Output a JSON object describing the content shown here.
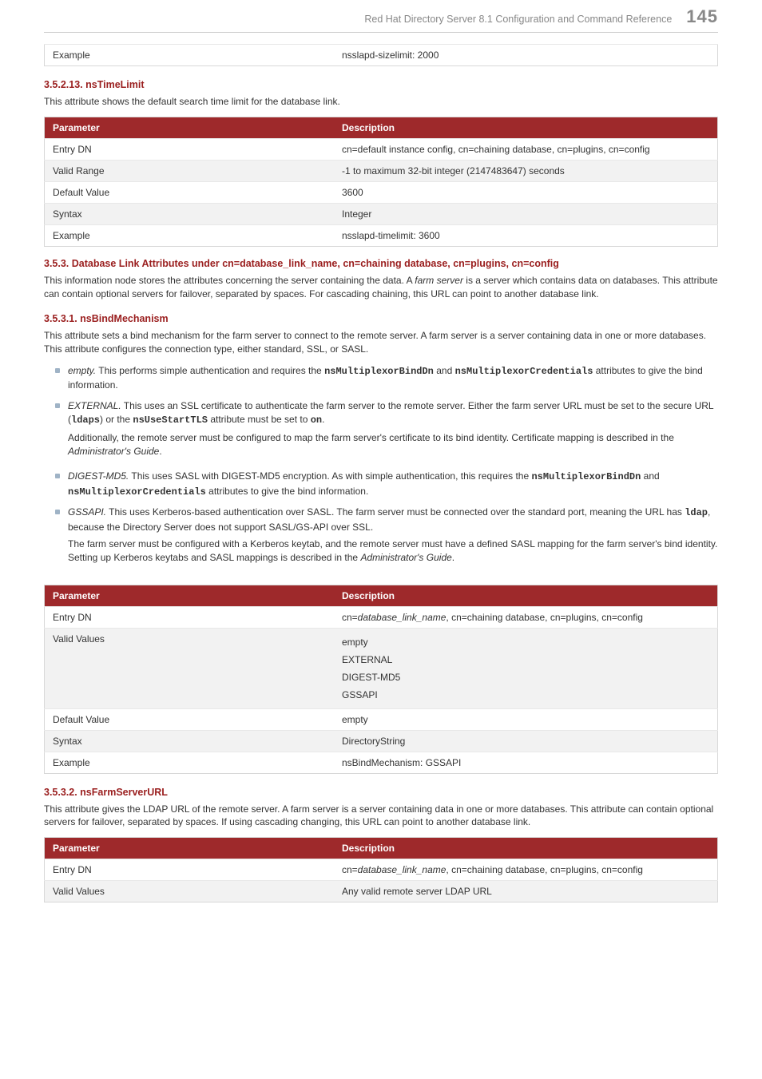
{
  "header": {
    "doc_title": "Red Hat Directory Server 8.1 Configuration and Command Reference",
    "page_number": "145"
  },
  "table_prev": {
    "r0c0": "Example",
    "r0c1": "nsslapd-sizelimit: 2000"
  },
  "sec_35213": {
    "heading": "3.5.2.13. nsTimeLimit",
    "intro": "This attribute shows the default search time limit for the database link.",
    "table": {
      "h0": "Parameter",
      "h1": "Description",
      "rows": [
        {
          "c0": "Entry DN",
          "c1": "cn=default instance config, cn=chaining database, cn=plugins, cn=config"
        },
        {
          "c0": "Valid Range",
          "c1": "-1 to maximum 32-bit integer (2147483647) seconds"
        },
        {
          "c0": "Default Value",
          "c1": "3600"
        },
        {
          "c0": "Syntax",
          "c1": "Integer"
        },
        {
          "c0": "Example",
          "c1": "nsslapd-timelimit: 3600"
        }
      ]
    }
  },
  "sec_353": {
    "heading": "3.5.3. Database Link Attributes under cn=database_link_name, cn=chaining database, cn=plugins, cn=config",
    "body_pre": "This information node stores the attributes concerning the server containing the data. A ",
    "body_italic": "farm server",
    "body_post": " is a server which contains data on databases. This attribute can contain optional servers for failover, separated by spaces. For cascading chaining, this URL can point to another database link."
  },
  "sec_3531": {
    "heading": "3.5.3.1. nsBindMechanism",
    "intro": "This attribute sets a bind mechanism for the farm server to connect to the remote server. A farm server is a server containing data in one or more databases. This attribute configures the connection type, either standard, SSL, or SASL.",
    "bullets": {
      "b1": {
        "name": "empty.",
        "t1": " This performs simple authentication and requires the ",
        "m1": "nsMultiplexorBindDn",
        "t2": " and ",
        "m2": "nsMultiplexorCredentials",
        "t3": " attributes to give the bind information."
      },
      "b2": {
        "name": "EXTERNAL.",
        "t1": " This uses an SSL certificate to authenticate the farm server to the remote server. Either the farm server URL must be set to the secure URL (",
        "m1": "ldaps",
        "t2": ") or the ",
        "m2": "nsUseStartTLS",
        "t3": " attribute must be set to ",
        "m3": "on",
        "t4": ".",
        "p2a": "Additionally, the remote server must be configured to map the farm server's certificate to its bind identity. Certificate mapping is described in the ",
        "p2i": "Administrator's Guide",
        "p2b": "."
      },
      "b3": {
        "name": "DIGEST-MD5.",
        "t1": " This uses SASL with DIGEST-MD5 encryption. As with simple authentication, this requires the ",
        "m1": "nsMultiplexorBindDn",
        "t2": " and ",
        "m2": "nsMultiplexorCredentials",
        "t3": " attributes to give the bind information."
      },
      "b4": {
        "name": "GSSAPI.",
        "t1": " This uses Kerberos-based authentication over SASL. The farm server must be connected over the standard port, meaning the URL has ",
        "m1": "ldap",
        "t2": ", because the Directory Server does not support SASL/GS-API over SSL.",
        "p2a": "The farm server must be configured with a Kerberos keytab, and the remote server must have a defined SASL mapping for the farm server's bind identity. Setting up Kerberos keytabs and SASL mappings is described in the ",
        "p2i": "Administrator's Guide",
        "p2b": "."
      }
    },
    "table": {
      "h0": "Parameter",
      "h1": "Description",
      "r0c0": "Entry DN",
      "r0c1a": "cn=",
      "r0c1i": "database_link_name",
      "r0c1b": ", cn=chaining database, cn=plugins, cn=config",
      "r1c0": "Valid Values",
      "r1v0": "empty",
      "r1v1": "EXTERNAL",
      "r1v2": "DIGEST-MD5",
      "r1v3": "GSSAPI",
      "r2c0": "Default Value",
      "r2c1": "empty",
      "r3c0": "Syntax",
      "r3c1": "DirectoryString",
      "r4c0": "Example",
      "r4c1": "nsBindMechanism: GSSAPI"
    }
  },
  "sec_3532": {
    "heading": "3.5.3.2. nsFarmServerURL",
    "intro": "This attribute gives the LDAP URL of the remote server. A farm server is a server containing data in one or more databases. This attribute can contain optional servers for failover, separated by spaces. If using cascading changing, this URL can point to another database link.",
    "table": {
      "h0": "Parameter",
      "h1": "Description",
      "r0c0": "Entry DN",
      "r0c1a": "cn=",
      "r0c1i": "database_link_name",
      "r0c1b": ", cn=chaining database, cn=plugins, cn=config",
      "r1c0": "Valid Values",
      "r1c1": "Any valid remote server LDAP URL"
    }
  }
}
